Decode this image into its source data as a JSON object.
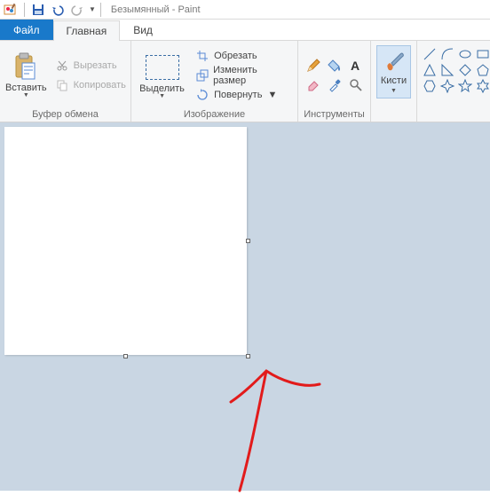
{
  "title": {
    "document": "Безымянный",
    "app": "Paint"
  },
  "tabs": {
    "file": "Файл",
    "home": "Главная",
    "view": "Вид"
  },
  "clipboard": {
    "paste": "Вставить",
    "cut": "Вырезать",
    "copy": "Копировать",
    "group": "Буфер обмена"
  },
  "image": {
    "select": "Выделить",
    "crop": "Обрезать",
    "resize": "Изменить размер",
    "rotate": "Повернуть",
    "group": "Изображение"
  },
  "tools": {
    "group": "Инструменты"
  },
  "brushes": {
    "label": "Кисти"
  }
}
